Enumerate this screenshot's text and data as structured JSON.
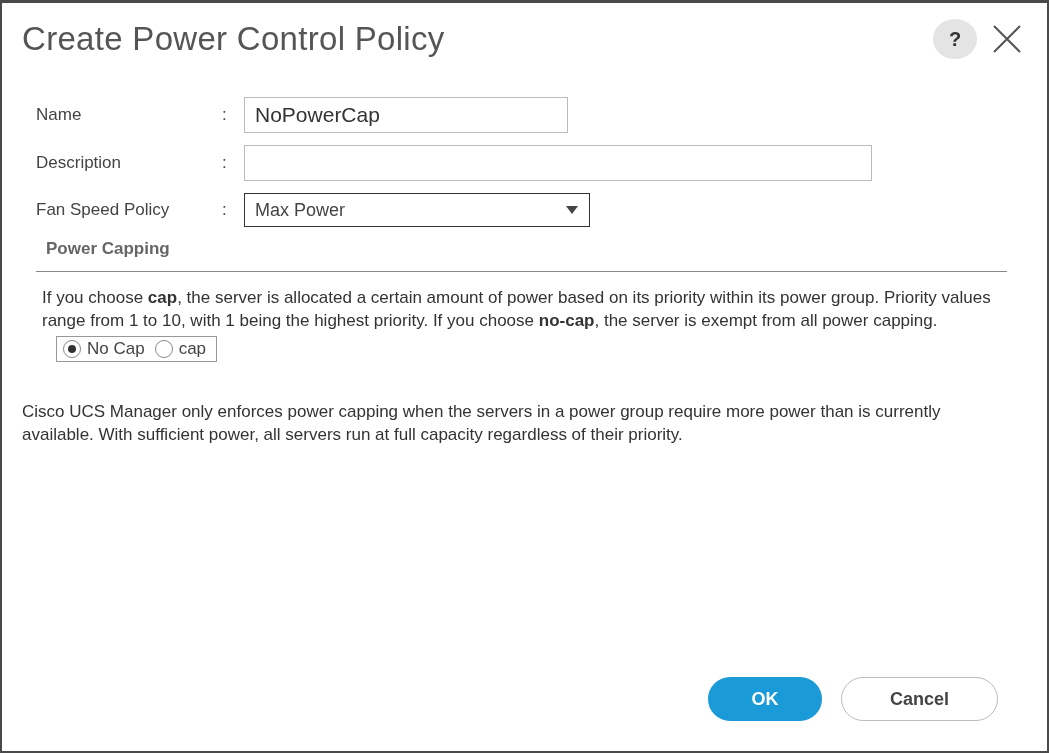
{
  "dialog": {
    "title": "Create Power Control Policy",
    "help": "?"
  },
  "fields": [
    {
      "kind": "text",
      "label": "Name",
      "separator": ":",
      "value": "NoPowerCap"
    },
    {
      "kind": "text",
      "label": "Description",
      "separator": ":"
    },
    {
      "kind": "select",
      "label": "Fan Speed Policy",
      "separator": ":",
      "value": "Max Power"
    }
  ],
  "power_capping": {
    "heading": "Power Capping",
    "description": "If you choose **cap**, the server is allocated a certain amount of power based on its priority within its power group. Priority values range from 1 to 10, with 1 being the highest priority. If you choose **no-cap**, the server is exempt from all power capping.",
    "options": [
      {
        "label": "No Cap",
        "selected": true
      },
      {
        "label": "cap",
        "selected": false
      }
    ]
  },
  "note": "Cisco UCS Manager only enforces power capping when the servers in a power group require more power than is currently available. With sufficient power, all servers run at full capacity regardless of their priority.",
  "buttons": [
    {
      "kind": "primary",
      "label": "OK"
    },
    {
      "kind": "secondary",
      "label": "Cancel"
    }
  ]
}
